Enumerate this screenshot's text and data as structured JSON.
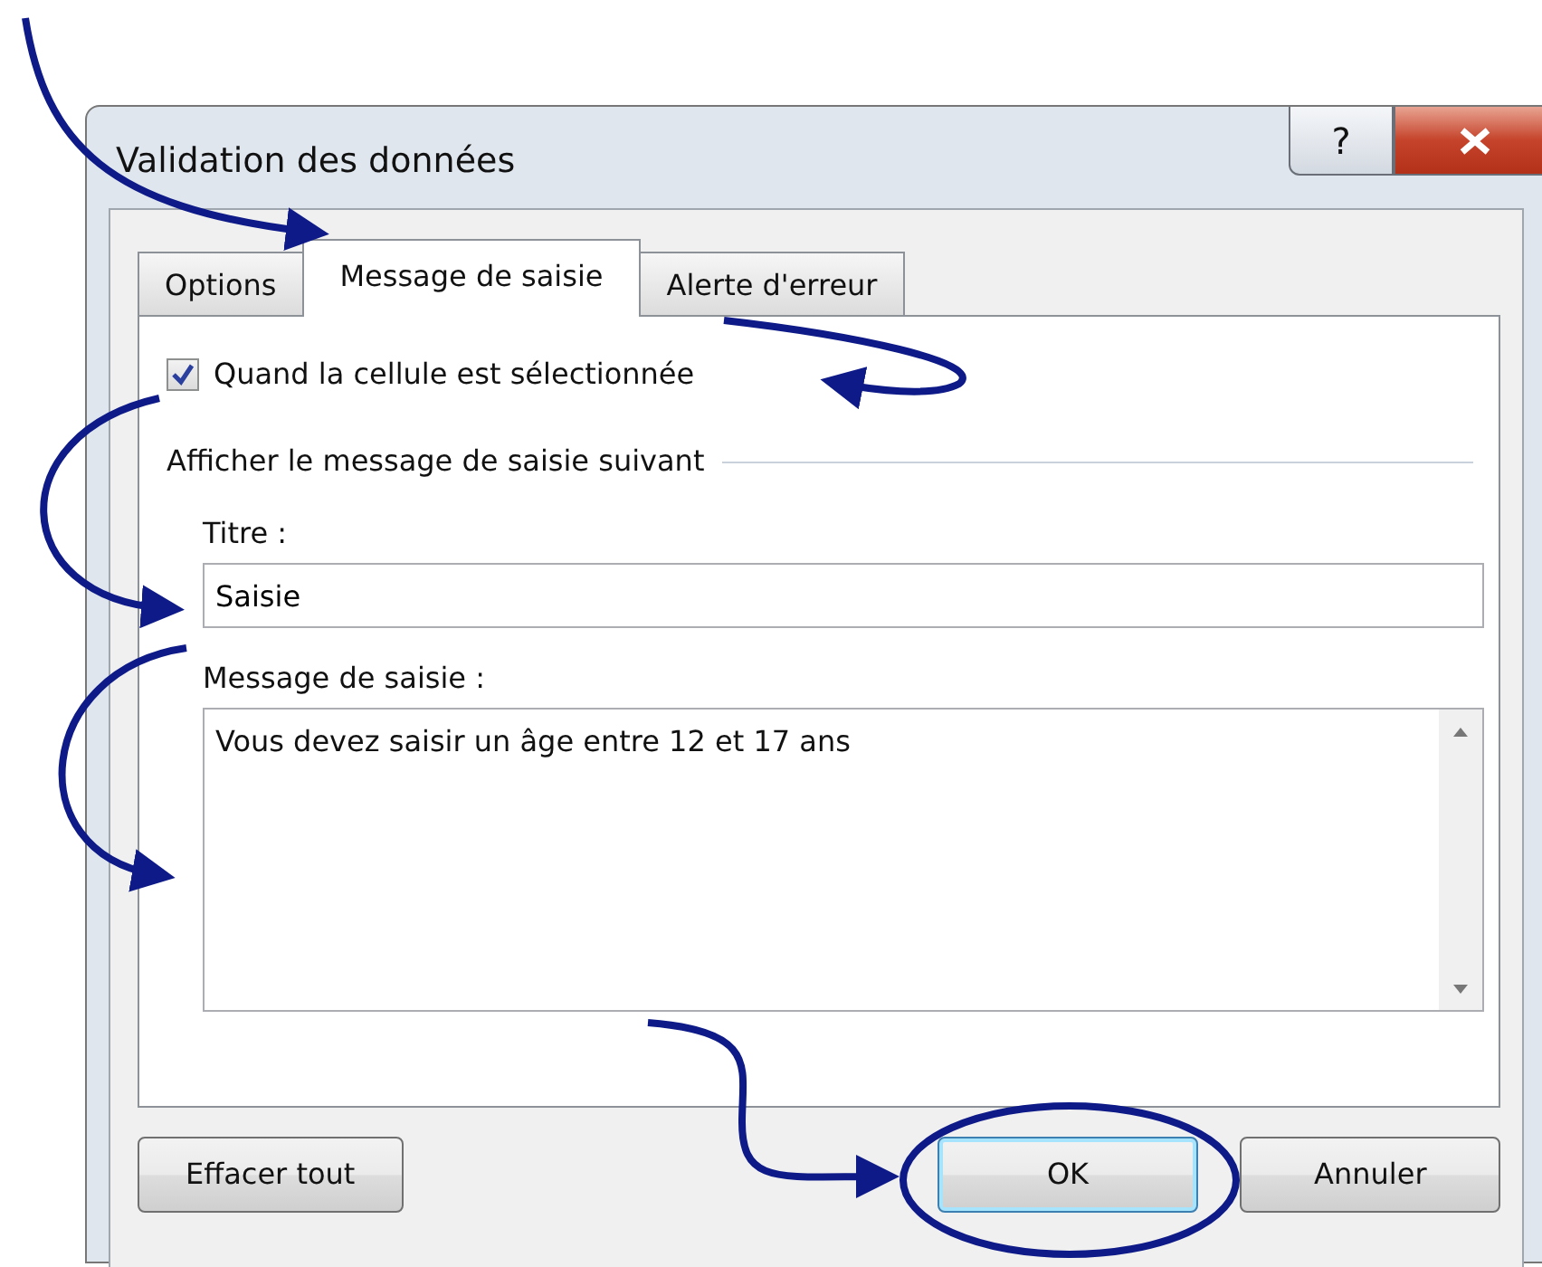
{
  "window": {
    "title": "Validation des données",
    "help": "?"
  },
  "tabs": [
    {
      "label": "Options",
      "selected": false
    },
    {
      "label": "Message de saisie",
      "selected": true
    },
    {
      "label": "Alerte d'erreur",
      "selected": false
    }
  ],
  "show_message": {
    "label": "Quand la cellule est sélectionnée",
    "checked": true
  },
  "group": {
    "title": "Afficher le message de saisie suivant"
  },
  "title_field": {
    "label": "Titre :",
    "value": "Saisie"
  },
  "message_field": {
    "label": "Message de saisie :",
    "value": "Vous devez saisir un âge entre 12 et 17 ans"
  },
  "buttons": [
    {
      "label": "Effacer tout",
      "default": false
    },
    {
      "label": "OK",
      "default": true
    },
    {
      "label": "Annuler",
      "default": false
    }
  ]
}
